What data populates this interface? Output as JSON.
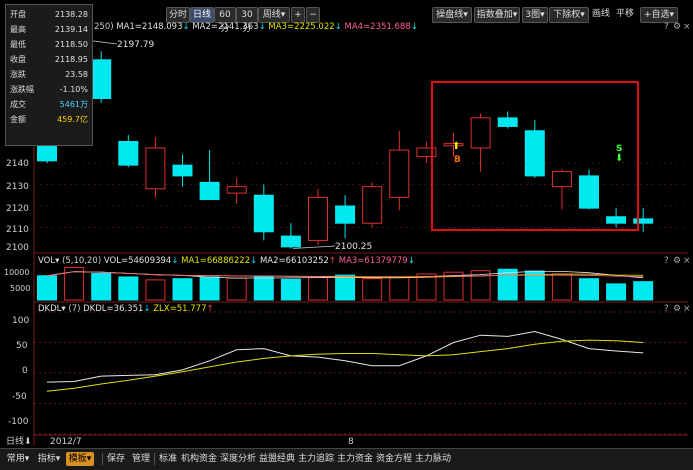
{
  "toolbar": {
    "period_buttons": [
      "分时",
      "日线",
      "60分",
      "30分",
      "周线"
    ],
    "period_buttons_arrow": [
      "",
      "",
      "",
      "",
      "▾"
    ],
    "active_period": "日线",
    "plus": "+",
    "minus": "−",
    "right_buttons": [
      "操盘线",
      "指数叠加",
      "3图",
      "下除权",
      "画线",
      "平移",
      "自选"
    ],
    "right_buttons_prefix": [
      "",
      "",
      "",
      "",
      "",
      "",
      "+"
    ],
    "right_buttons_arrow": [
      "▾",
      "▾",
      "▾",
      "▾",
      "",
      "",
      "▾"
    ]
  },
  "info_panel": {
    "rows": [
      {
        "label": "开盘",
        "value": "2138.28",
        "color": "#e0e0e0"
      },
      {
        "label": "最高",
        "value": "2139.14",
        "color": "#e0e0e0"
      },
      {
        "label": "最低",
        "value": "2118.50",
        "color": "#e0e0e0"
      },
      {
        "label": "收盘",
        "value": "2118.95",
        "color": "#e0e0e0"
      },
      {
        "label": "涨跌",
        "value": "23.58",
        "color": "#e0e0e0"
      },
      {
        "label": "涨跌幅",
        "value": "-1.10%",
        "color": "#e0e0e0"
      },
      {
        "label": "成交",
        "value": "5461万",
        "color": "#4fd2ff"
      },
      {
        "label": "金额",
        "value": "459.7亿",
        "color": "#ffd400"
      }
    ]
  },
  "price_panel": {
    "ma_prefix": "250)",
    "ma_items": [
      {
        "text": "MA1=2148.093",
        "arrow": "↓",
        "color": "#e0e0e0"
      },
      {
        "text": "MA2=2141.363",
        "arrow": "↓",
        "color": "#e0e0e0"
      },
      {
        "text": "MA3=2225.022",
        "arrow": "↓",
        "color": "#e0e000"
      },
      {
        "text": "MA4=2351.688",
        "arrow": "↓",
        "color": "#ff6090"
      }
    ],
    "high_label": "2197.79",
    "low_label": "2100.25",
    "buy_label": "B",
    "sell_label": "S",
    "y_ticks": [
      "2140",
      "2130",
      "2120",
      "2110",
      "2100"
    ],
    "highlight_color": "#e01010"
  },
  "volume_panel": {
    "title": "VOL",
    "params": "(5,10,20)",
    "items": [
      {
        "text": "VOL=54609394",
        "arrow": "↓",
        "color": "#e0e0e0"
      },
      {
        "text": "MA1=66886222",
        "arrow": "↓",
        "color": "#e0e000"
      },
      {
        "text": "MA2=66103252",
        "arrow": "↑",
        "color": "#e0e0e0"
      },
      {
        "text": "MA3=61379779",
        "arrow": "↓",
        "color": "#ff6090"
      }
    ],
    "y_ticks": [
      "10000",
      "5000"
    ]
  },
  "dkdl_panel": {
    "title": "DKDL",
    "params": "(7)",
    "items": [
      {
        "text": "DKDL=36.351",
        "arrow": "↓",
        "color": "#e0e0e0"
      },
      {
        "text": "ZLX=51.777",
        "arrow": "↑",
        "color": "#e0e000"
      }
    ],
    "y_ticks": [
      "100",
      "50",
      "0",
      "-50",
      "-100"
    ]
  },
  "x_axis": {
    "period_label": "日线",
    "month_label": "2012/7",
    "day_label": "8"
  },
  "bottom_bar": {
    "buttons": [
      "常用",
      "指标",
      "模板",
      "保存",
      "管理",
      "标准",
      "机构资金",
      "深度分析",
      "益盟经典",
      "主力追踪",
      "主力资金",
      "资金方程",
      "主力脉动"
    ],
    "arrows": [
      "▾",
      "▾",
      "▾",
      "",
      "",
      "",
      "",
      "",
      "",
      "",
      "",
      "",
      ""
    ],
    "active": "模板"
  },
  "colors": {
    "up": "#e03030",
    "down": "#00e8f0",
    "ma_white": "#e0e0e0",
    "ma_yellow": "#e0e000",
    "ma_pink": "#ff6090"
  },
  "chart_data": {
    "type": "candlestick",
    "y_ticks": [
      2140,
      2130,
      2120,
      2110,
      2100
    ],
    "ohlc_note": "Daily candles; values estimated from axis.",
    "candles": [
      {
        "o": 2160,
        "h": 2165,
        "l": 2140,
        "c": 2141
      },
      {
        "o": 2178,
        "h": 2197.79,
        "l": 2150,
        "c": 2195
      },
      {
        "o": 2188,
        "h": 2192,
        "l": 2168,
        "c": 2170
      },
      {
        "o": 2150,
        "h": 2153,
        "l": 2138,
        "c": 2139
      },
      {
        "o": 2128,
        "h": 2152,
        "l": 2124,
        "c": 2147
      },
      {
        "o": 2139,
        "h": 2144,
        "l": 2129,
        "c": 2134
      },
      {
        "o": 2131,
        "h": 2146,
        "l": 2124,
        "c": 2123
      },
      {
        "o": 2126,
        "h": 2133,
        "l": 2121,
        "c": 2129
      },
      {
        "o": 2125,
        "h": 2130,
        "l": 2104,
        "c": 2108
      },
      {
        "o": 2106,
        "h": 2112,
        "l": 2100.25,
        "c": 2101
      },
      {
        "o": 2104,
        "h": 2128,
        "l": 2102,
        "c": 2124
      },
      {
        "o": 2120,
        "h": 2125,
        "l": 2105,
        "c": 2112
      },
      {
        "o": 2112,
        "h": 2131,
        "l": 2110,
        "c": 2129
      },
      {
        "o": 2124,
        "h": 2155,
        "l": 2118,
        "c": 2146
      },
      {
        "o": 2143,
        "h": 2150,
        "l": 2140,
        "c": 2147
      },
      {
        "o": 2148,
        "h": 2154,
        "l": 2143,
        "c": 2149
      },
      {
        "o": 2147,
        "h": 2163,
        "l": 2136,
        "c": 2161
      },
      {
        "o": 2161,
        "h": 2164,
        "l": 2156,
        "c": 2157
      },
      {
        "o": 2155,
        "h": 2160,
        "l": 2133,
        "c": 2134
      },
      {
        "o": 2129,
        "h": 2137,
        "l": 2118.5,
        "c": 2136
      },
      {
        "o": 2134,
        "h": 2137,
        "l": 2118.5,
        "c": 2119
      },
      {
        "o": 2115,
        "h": 2119,
        "l": 2110,
        "c": 2112
      },
      {
        "o": 2114,
        "h": 2119,
        "l": 2108,
        "c": 2112
      }
    ],
    "volume": [
      8200,
      11000,
      9000,
      7800,
      6800,
      7200,
      7800,
      7400,
      8000,
      7000,
      7600,
      8400,
      7200,
      7600,
      8800,
      9400,
      9900,
      10400,
      9800,
      8800,
      7200,
      5461,
      6200
    ],
    "dkdl_panel": {
      "y_ticks": [
        100,
        50,
        0,
        -50,
        -100
      ],
      "dkdl": [
        -15,
        -14,
        -5,
        -4,
        -3,
        5,
        20,
        38,
        40,
        28,
        26,
        20,
        12,
        12,
        28,
        50,
        62,
        60,
        68,
        55,
        40,
        36,
        33
      ],
      "zlx": [
        -30,
        -25,
        -18,
        -12,
        -5,
        2,
        10,
        18,
        24,
        28,
        31,
        32,
        32,
        30,
        28,
        30,
        35,
        40,
        47,
        52,
        54,
        53,
        50
      ]
    }
  }
}
